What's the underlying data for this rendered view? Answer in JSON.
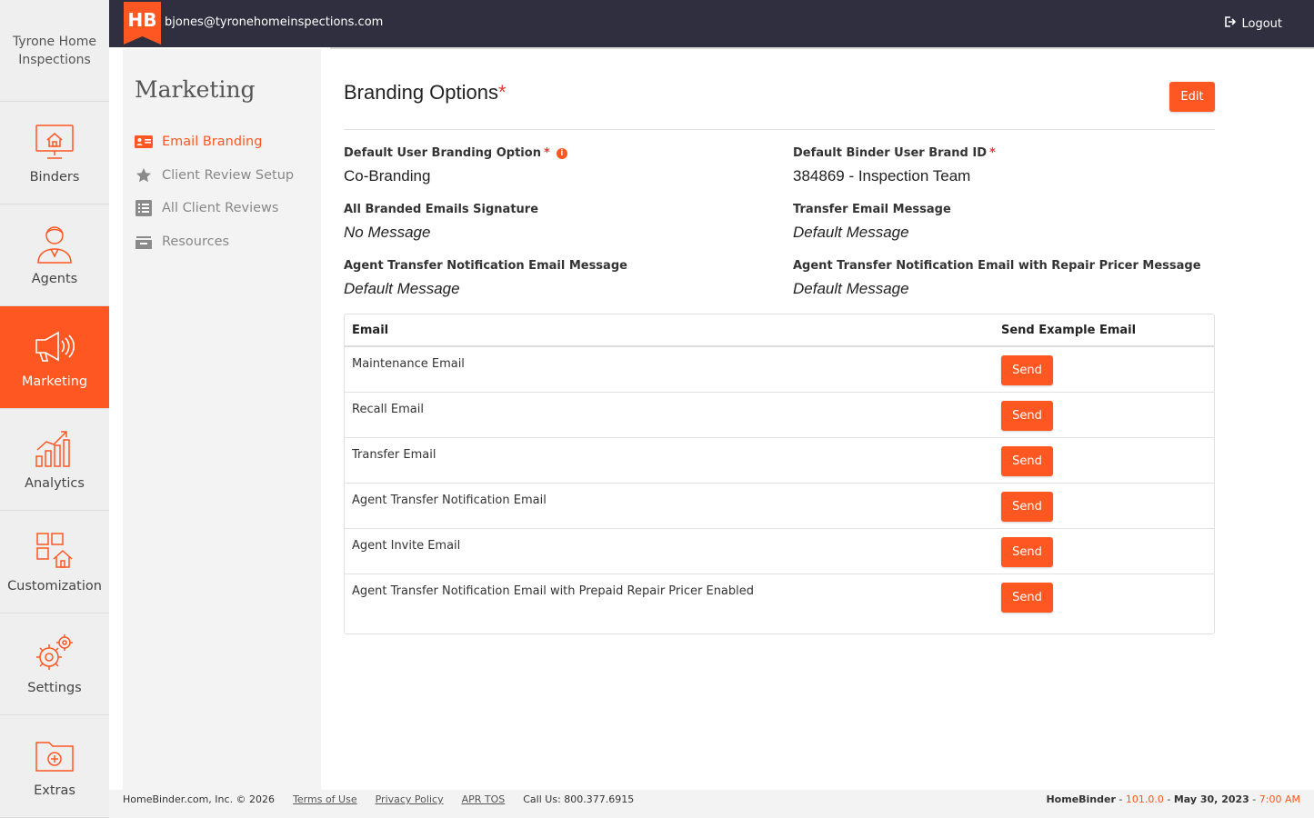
{
  "company": {
    "name": "Tyrone Home Inspections"
  },
  "rail": {
    "items": [
      {
        "label": "Binders",
        "icon": "house-monitor-icon"
      },
      {
        "label": "Agents",
        "icon": "agent-person-icon"
      },
      {
        "label": "Marketing",
        "icon": "megaphone-icon",
        "active": true
      },
      {
        "label": "Analytics",
        "icon": "bar-chart-icon"
      },
      {
        "label": "Customization",
        "icon": "customization-grid-icon"
      },
      {
        "label": "Settings",
        "icon": "gears-icon"
      },
      {
        "label": "Extras",
        "icon": "folder-plus-icon"
      }
    ]
  },
  "topbar": {
    "logo_text": "HB",
    "email": "bjones@tyronehomeinspections.com",
    "logout_label": "Logout"
  },
  "subnav": {
    "title": "Marketing",
    "items": [
      {
        "label": "Email Branding",
        "icon": "id-card-icon",
        "active": true
      },
      {
        "label": "Client Review Setup",
        "icon": "star-icon"
      },
      {
        "label": "All Client Reviews",
        "icon": "list-icon"
      },
      {
        "label": "Resources",
        "icon": "tray-icon"
      }
    ]
  },
  "main": {
    "title": "Branding Options",
    "required_mark": "*",
    "edit_label": "Edit",
    "fields": {
      "default_user_branding": {
        "label": "Default User Branding Option",
        "value": "Co-Branding"
      },
      "default_binder_brand": {
        "label": "Default Binder User Brand ID",
        "value": "384869 - Inspection Team"
      },
      "branded_signature": {
        "label": "All Branded Emails Signature",
        "value": "No Message"
      },
      "transfer_message": {
        "label": "Transfer Email Message",
        "value": "Default Message"
      },
      "agent_transfer_message": {
        "label": "Agent Transfer Notification Email Message",
        "value": "Default Message"
      },
      "agent_transfer_repair_message": {
        "label": "Agent Transfer Notification Email with Repair Pricer Message",
        "value": "Default Message"
      }
    },
    "table": {
      "headers": [
        "Email",
        "Send Example Email"
      ],
      "send_label": "Send",
      "rows": [
        "Maintenance Email",
        "Recall Email",
        "Transfer Email",
        "Agent Transfer Notification Email",
        "Agent Invite Email",
        "Agent Transfer Notification Email with Prepaid Repair Pricer Enabled"
      ]
    }
  },
  "footer": {
    "copyright": "HomeBinder.com, Inc.  ©  2026",
    "links": [
      "Terms of Use",
      "Privacy Policy",
      "APR TOS"
    ],
    "phone": "Call Us: 800.377.6915",
    "brand": "HomeBinder",
    "version": "101.0.0",
    "date": "May 30, 2023",
    "time": "7:00 AM"
  },
  "colors": {
    "accent": "#ff5722",
    "topbar": "#2f2f3f"
  }
}
